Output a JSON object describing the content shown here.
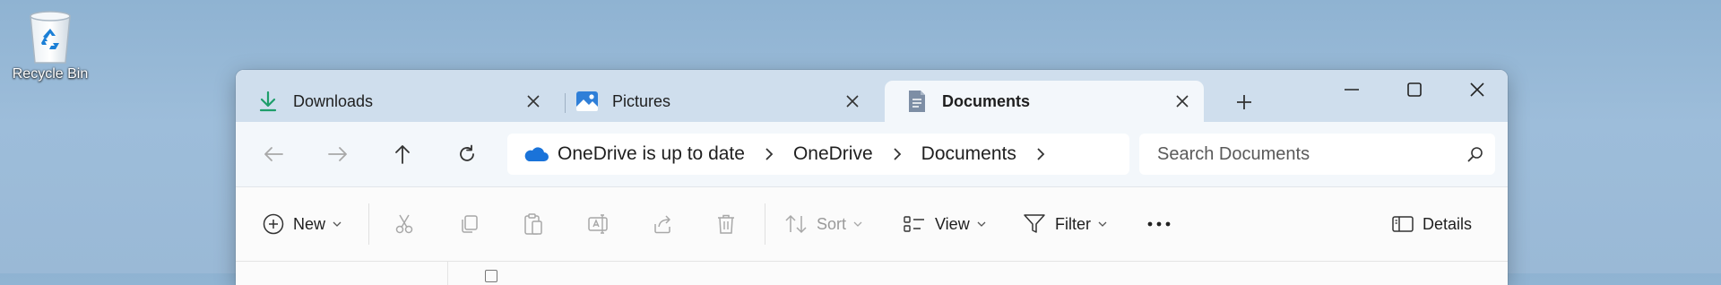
{
  "desktop": {
    "recycle_bin_label": "Recycle Bin"
  },
  "tabs": [
    {
      "label": "Downloads",
      "icon": "download-icon",
      "active": false
    },
    {
      "label": "Pictures",
      "icon": "pictures-icon",
      "active": false
    },
    {
      "label": "Documents",
      "icon": "documents-icon",
      "active": true
    }
  ],
  "window_controls": {
    "minimize": "minimize-icon",
    "maximize": "maximize-icon",
    "close": "close-icon"
  },
  "address_bar": {
    "status": "OneDrive is up to date",
    "crumbs": [
      "OneDrive",
      "Documents"
    ]
  },
  "search": {
    "placeholder": "Search Documents"
  },
  "toolbar": {
    "new_label": "New",
    "sort_label": "Sort",
    "view_label": "View",
    "filter_label": "Filter",
    "details_label": "Details"
  },
  "colors": {
    "accent": "#0067c0",
    "onedrive_blue": "#1a73d9",
    "download_green": "#1e9e6a",
    "titlebar_bg": "#cfdeed",
    "navbar_bg": "#f3f7fb"
  }
}
